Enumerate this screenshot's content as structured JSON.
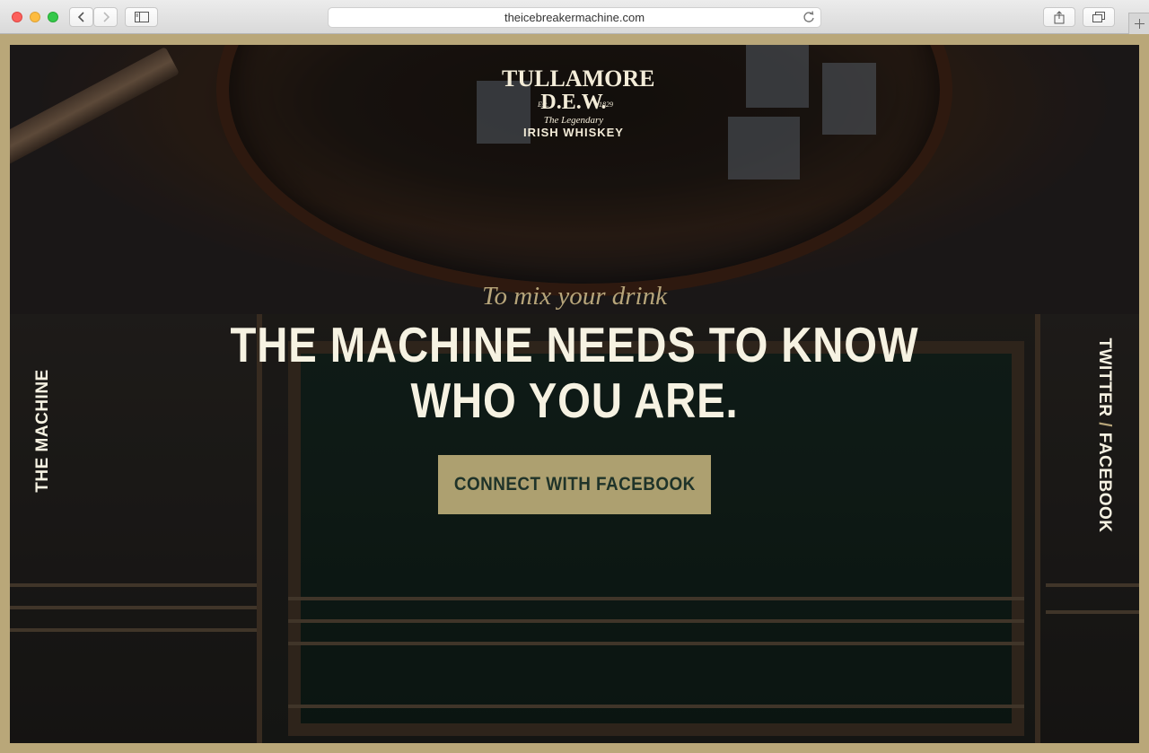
{
  "browser": {
    "url": "theicebreakermachine.com"
  },
  "logo": {
    "line1": "TULLAMORE",
    "line2": "D.E.W.",
    "est": "Est.",
    "year": "1829",
    "line3": "The Legendary",
    "line4": "IRISH WHISKEY"
  },
  "hero": {
    "tagline": "To mix your drink",
    "headline_line1": "THE MACHINE NEEDS TO KNOW",
    "headline_line2": "WHO YOU ARE.",
    "cta_label": "CONNECT WITH FACEBOOK"
  },
  "side_nav": {
    "left_label": "THE MACHINE",
    "right_twitter": "TWITTER",
    "right_separator": "/",
    "right_facebook": "FACEBOOK"
  },
  "colors": {
    "frame": "#b9a779",
    "cta_bg": "#ada070",
    "cta_text": "#1f3329",
    "headline": "#f6f2e2",
    "tagline": "#b7a57a"
  }
}
